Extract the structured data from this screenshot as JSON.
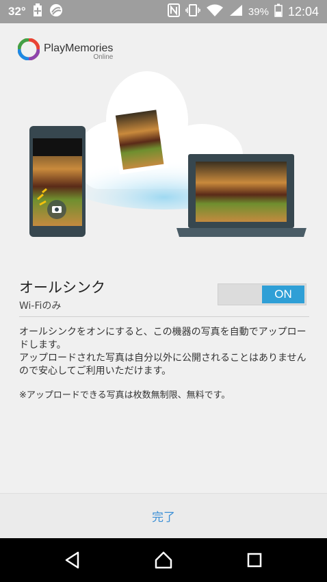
{
  "status_bar": {
    "temperature": "32°",
    "battery_percent": "39%",
    "time": "12:04"
  },
  "app": {
    "logo_name": "PlayMemories",
    "logo_sub": "Online"
  },
  "sync": {
    "title": "オールシンク",
    "subtitle": "Wi-Fiのみ",
    "toggle_label": "ON",
    "toggle_on": true
  },
  "description": {
    "paragraph1": "オールシンクをオンにすると、この機器の写真を自動でアップロードします。",
    "paragraph2": "アップロードされた写真は自分以外に公開されることはありませんので安心してご利用いただけます。",
    "note": "※アップロードできる写真は枚数無制限、無料です。"
  },
  "footer": {
    "done_label": "完了"
  },
  "colors": {
    "accent": "#2f9fd6",
    "link": "#3b8fd6",
    "status_bar": "#9e9e9e"
  }
}
